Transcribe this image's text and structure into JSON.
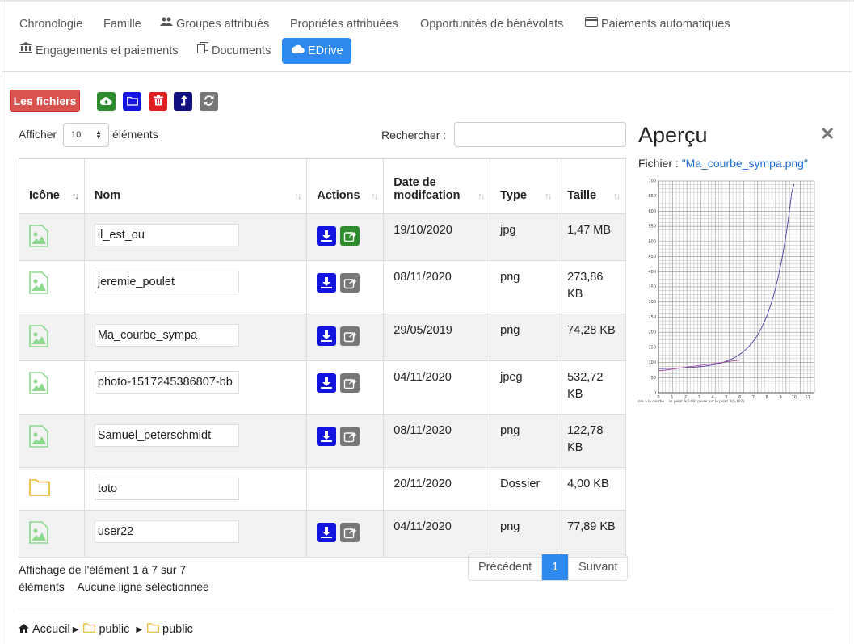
{
  "tabs": [
    {
      "label": "Chronologie",
      "icon": "none"
    },
    {
      "label": "Famille",
      "icon": "none"
    },
    {
      "label": "Groupes attribués",
      "icon": "users-icon"
    },
    {
      "label": "Propriétés attribuées",
      "icon": "none"
    },
    {
      "label": "Opportunités de bénévolats",
      "icon": "none"
    },
    {
      "label": "Paiements automatiques",
      "icon": "credit-card-icon"
    },
    {
      "label": "Engagements et paiements",
      "icon": "bank-icon"
    },
    {
      "label": "Documents",
      "icon": "copy-icon"
    },
    {
      "label": "EDrive",
      "icon": "cloud-icon",
      "active": true
    }
  ],
  "toolbar": {
    "files_label": "Les fichiers",
    "buttons": [
      {
        "icon": "cloud-upload-icon",
        "color": "#2e8b2e"
      },
      {
        "icon": "folder-icon",
        "color": "#1414e0"
      },
      {
        "icon": "trash-icon",
        "color": "#e02020"
      },
      {
        "icon": "level-up-icon",
        "color": "#101080"
      },
      {
        "icon": "refresh-icon",
        "color": "#777777"
      }
    ]
  },
  "controls": {
    "show_label": "Afficher",
    "show_value": "10",
    "elements_label": "éléments",
    "search_label": "Rechercher :",
    "search_value": ""
  },
  "table": {
    "headers": {
      "icon": "Icône",
      "name": "Nom",
      "actions": "Actions",
      "date_line1": "Date de",
      "date_line2": "modifcation",
      "type": "Type",
      "size": "Taille"
    },
    "rows": [
      {
        "icon": "image-icon",
        "name": "il_est_ou",
        "date": "19/10/2020",
        "type": "jpg",
        "size": "1,47 MB",
        "size2": "",
        "actions": true,
        "share_color": "green"
      },
      {
        "icon": "image-icon",
        "name": "jeremie_poulet",
        "date": "08/11/2020",
        "type": "png",
        "size": "273,86",
        "size2": "KB",
        "actions": true,
        "share_color": "grey"
      },
      {
        "icon": "image-icon",
        "name": "Ma_courbe_sympa",
        "date": "29/05/2019",
        "type": "png",
        "size": "74,28 KB",
        "size2": "",
        "actions": true,
        "share_color": "grey"
      },
      {
        "icon": "image-icon",
        "name": "photo-1517245386807-bb",
        "date": "04/11/2020",
        "type": "jpeg",
        "size": "532,72",
        "size2": "KB",
        "actions": true,
        "share_color": "grey"
      },
      {
        "icon": "image-icon",
        "name": "Samuel_peterschmidt",
        "date": "08/11/2020",
        "type": "png",
        "size": "122,78",
        "size2": "KB",
        "actions": true,
        "share_color": "grey"
      },
      {
        "icon": "folder-icon",
        "name": "toto",
        "date": "20/11/2020",
        "type": "Dossier",
        "size": "4,00 KB",
        "size2": "",
        "actions": false,
        "share_color": ""
      },
      {
        "icon": "image-icon",
        "name": "user22",
        "date": "04/11/2020",
        "type": "png",
        "size": "77,89 KB",
        "size2": "",
        "actions": true,
        "share_color": "grey"
      }
    ]
  },
  "info": {
    "line1": "Affichage de l'élément 1 à 7 sur 7",
    "line2_a": "éléments",
    "line2_b": "Aucune ligne sélectionnée"
  },
  "pager": {
    "prev": "Précédent",
    "current": "1",
    "next": "Suivant"
  },
  "breadcrumb": {
    "home": "Accueil",
    "items": [
      "public",
      "public"
    ]
  },
  "preview": {
    "title": "Aperçu",
    "file_label": "Fichier : ",
    "file_name": "\"Ma_courbe_sympa.png\""
  },
  "colors": {
    "accent": "#2f8af0",
    "danger": "#d9534f",
    "image_icon": "#8fd88f",
    "folder_icon": "#f0b429"
  }
}
